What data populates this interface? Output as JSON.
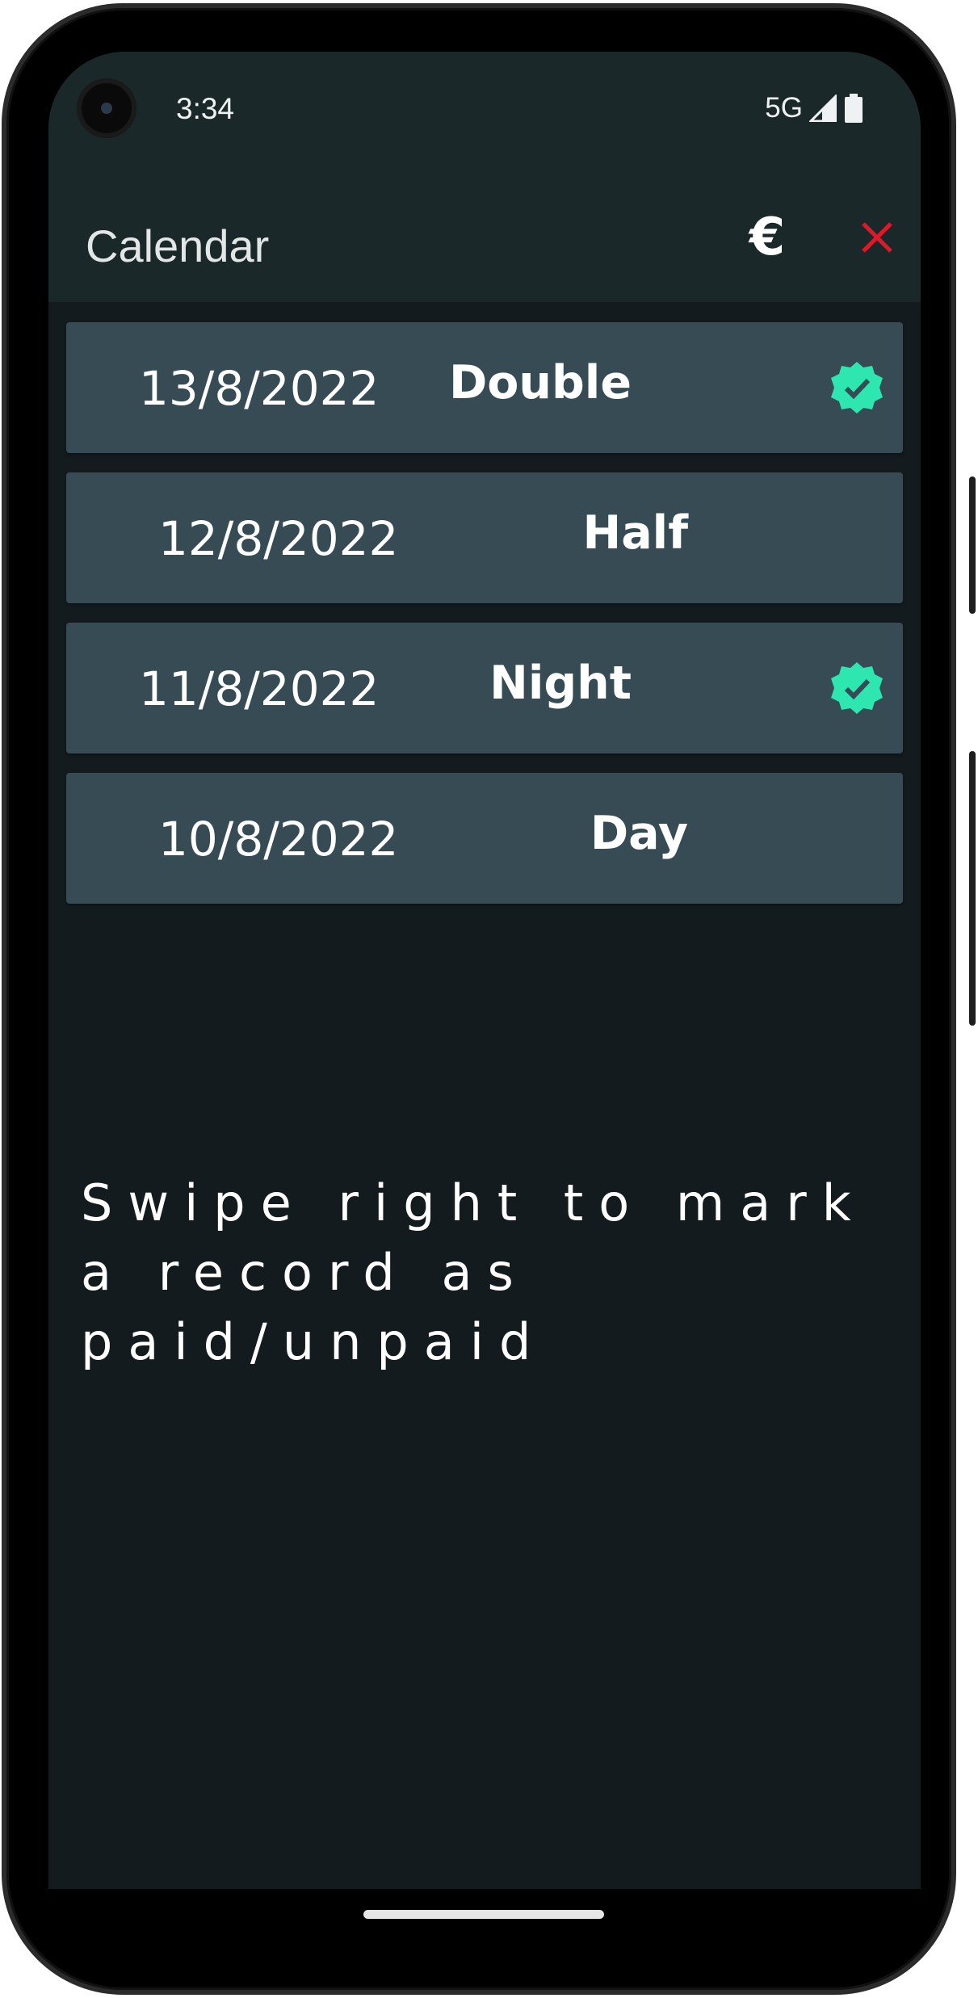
{
  "status_bar": {
    "time": "3:34",
    "network": "5G",
    "signal_icon": "cellular-signal-icon",
    "battery_icon": "battery-icon"
  },
  "app_bar": {
    "title": "Calendar",
    "currency_icon": "euro-icon",
    "currency_symbol": "€",
    "close_icon": "close-icon",
    "close_color": "#e0192a"
  },
  "records": [
    {
      "date": "13/8/2022",
      "shift": "Double",
      "paid": true
    },
    {
      "date": "12/8/2022",
      "shift": "Half",
      "paid": false
    },
    {
      "date": "11/8/2022",
      "shift": "Night",
      "paid": true
    },
    {
      "date": "10/8/2022",
      "shift": "Day",
      "paid": false
    }
  ],
  "paid_badge": {
    "icon": "verified-check-icon",
    "color": "#2ee6b0"
  },
  "hint": "Swipe right to mark a record as paid/unpaid",
  "colors": {
    "app_bar": "#1b2829",
    "background": "#131b1f",
    "row": "#364b53"
  }
}
